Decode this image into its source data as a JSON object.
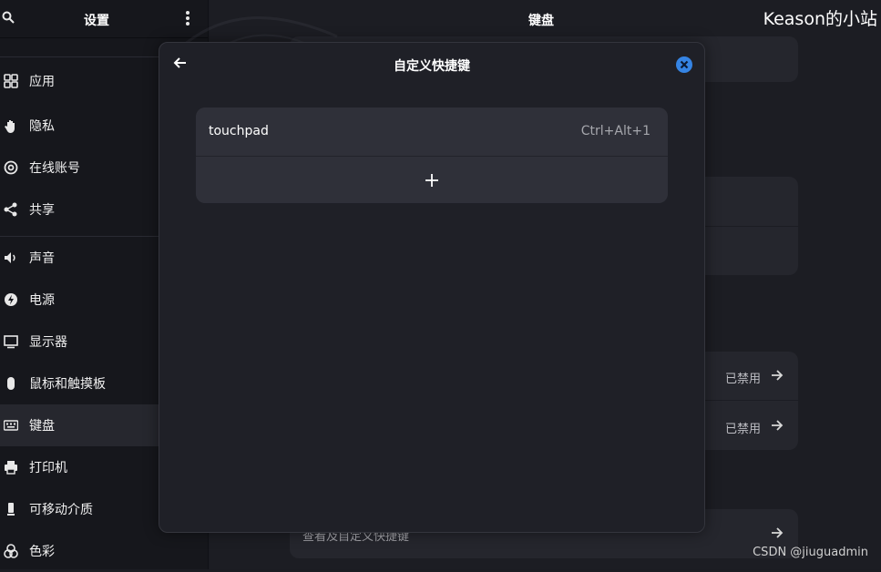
{
  "sidebar": {
    "title": "设置",
    "items": [
      {
        "label": "应用",
        "icon": "apps-grid-icon"
      },
      {
        "label": "隐私",
        "icon": "hand-icon"
      },
      {
        "label": "在线账号",
        "icon": "at-sign-icon"
      },
      {
        "label": "共享",
        "icon": "share-icon"
      },
      {
        "label": "声音",
        "icon": "speaker-icon"
      },
      {
        "label": "电源",
        "icon": "power-icon"
      },
      {
        "label": "显示器",
        "icon": "display-icon"
      },
      {
        "label": "鼠标和触摸板",
        "icon": "mouse-icon"
      },
      {
        "label": "键盘",
        "icon": "keyboard-icon",
        "active": true
      },
      {
        "label": "打印机",
        "icon": "printer-icon"
      },
      {
        "label": "可移动介质",
        "icon": "usb-drive-icon"
      },
      {
        "label": "色彩",
        "icon": "color-icon"
      }
    ]
  },
  "main": {
    "title": "键盘",
    "rows": [
      {
        "status": "已禁用"
      },
      {
        "status": "已禁用"
      }
    ],
    "bottom_row_label": "查看及自定义快捷键"
  },
  "dialog": {
    "title": "自定义快捷键",
    "shortcuts": [
      {
        "name": "touchpad",
        "accel": "Ctrl+Alt+1"
      }
    ]
  },
  "watermark": {
    "top": "Keason的小站",
    "bottom": "CSDN @jiuguadmin"
  },
  "colors": {
    "accent": "#3584e4",
    "background": "#1c1d23",
    "card": "#2f3039"
  }
}
